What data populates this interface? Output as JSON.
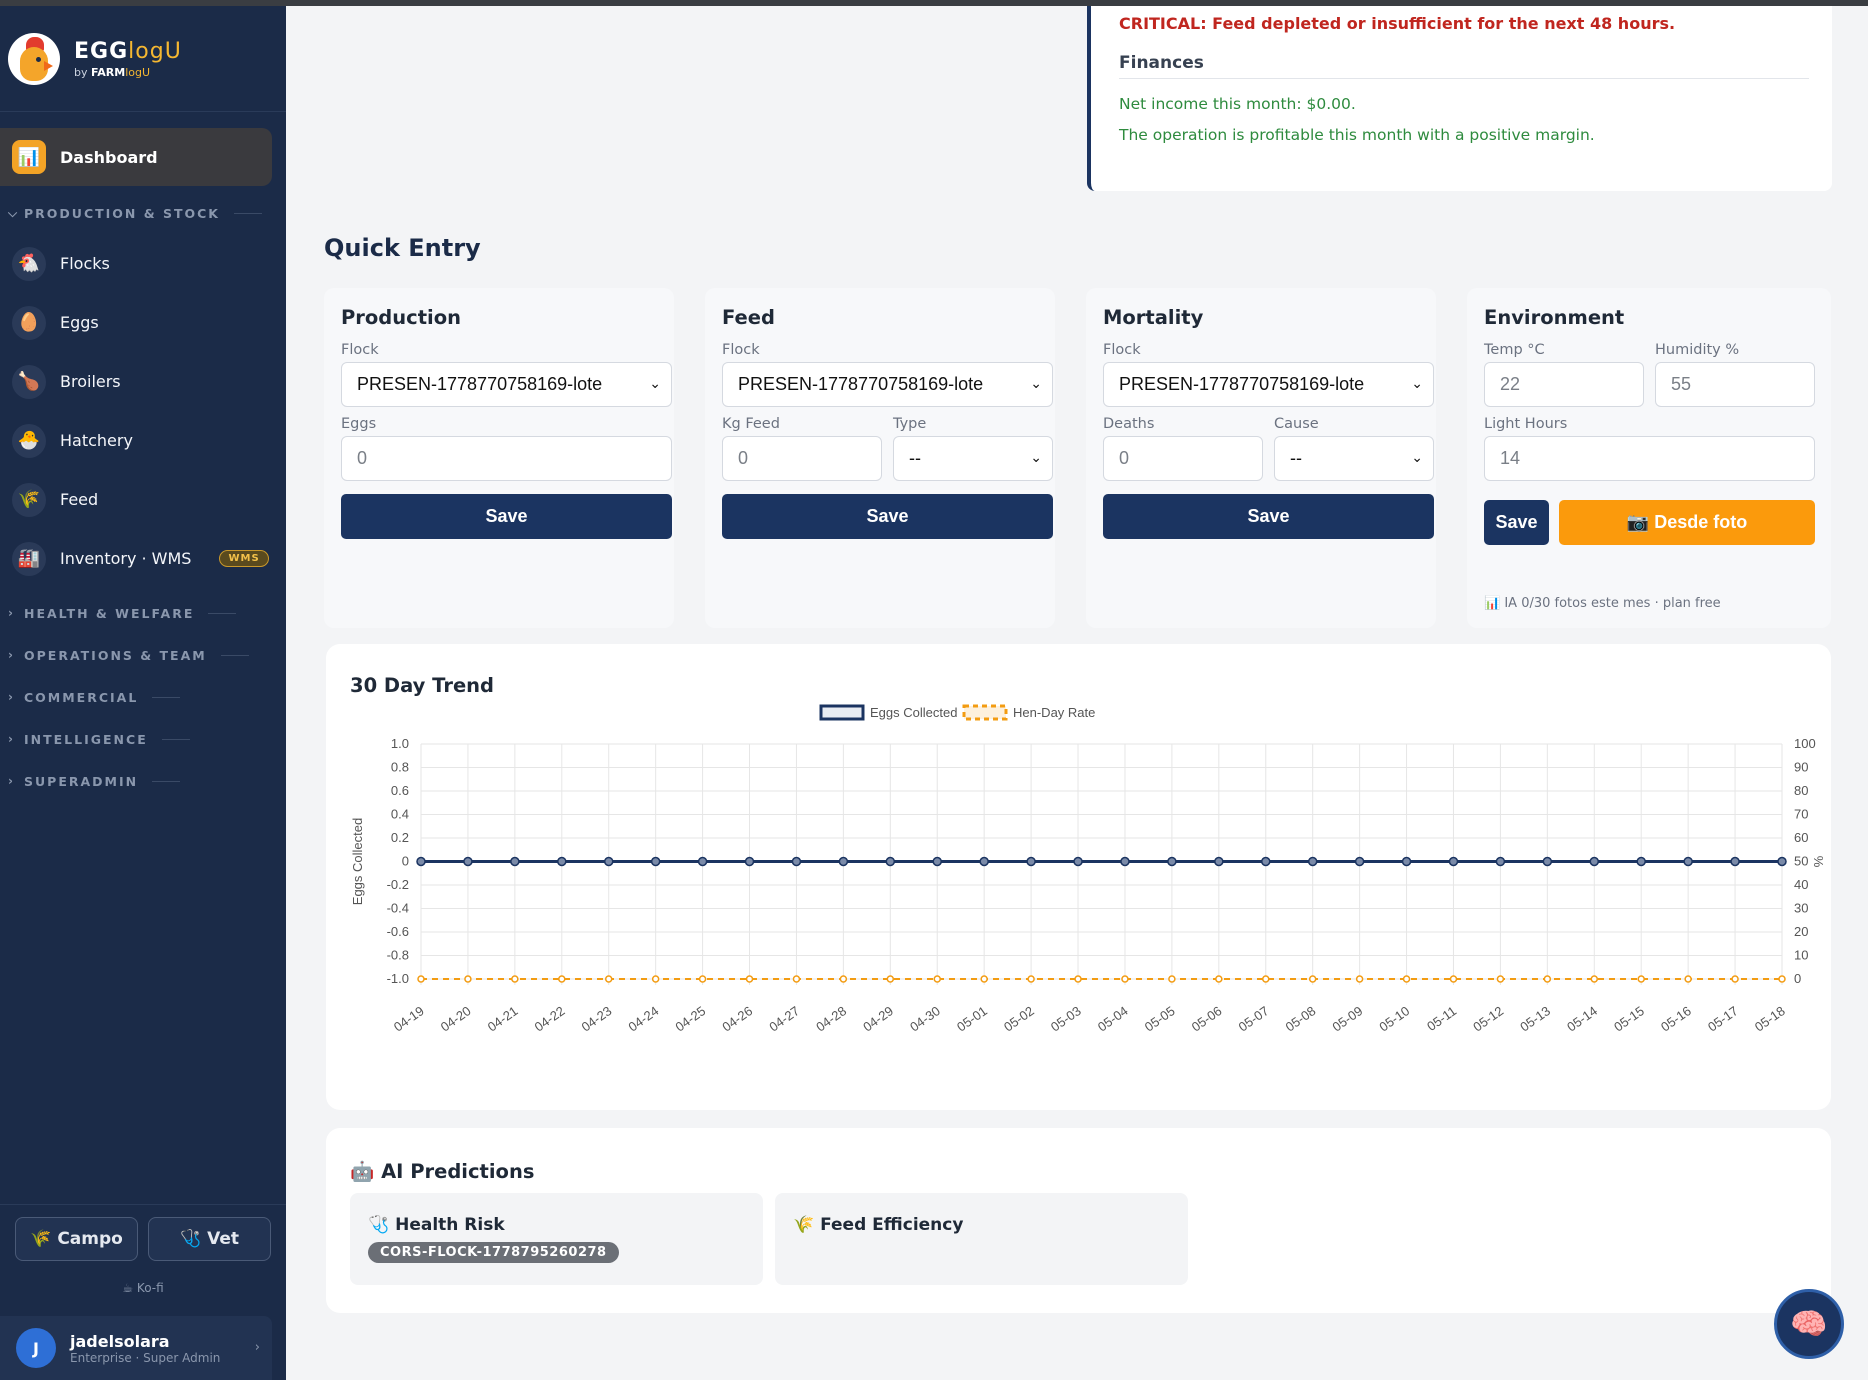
{
  "brand": {
    "name_a": "EGG",
    "name_b": "logU",
    "sub_a": "by ",
    "sub_b": "FARM",
    "sub_c": "logU"
  },
  "sidebar": {
    "active": {
      "label": "Dashboard",
      "icon": "chart-icon"
    },
    "sections": [
      {
        "label": "PRODUCTION & STOCK",
        "expanded": true
      },
      {
        "label": "HEALTH & WELFARE"
      },
      {
        "label": "OPERATIONS & TEAM"
      },
      {
        "label": "COMMERCIAL"
      },
      {
        "label": "INTELLIGENCE"
      },
      {
        "label": "SUPERADMIN"
      }
    ],
    "items": [
      {
        "label": "Flocks",
        "icon": "hen-icon"
      },
      {
        "label": "Eggs",
        "icon": "egg-icon"
      },
      {
        "label": "Broilers",
        "icon": "drumstick-icon"
      },
      {
        "label": "Hatchery",
        "icon": "chick-icon"
      },
      {
        "label": "Feed",
        "icon": "wheat-icon"
      },
      {
        "label": "Inventory · WMS",
        "icon": "factory-icon",
        "badge": "WMS"
      }
    ],
    "buttons": {
      "campo": "Campo",
      "vet": "Vet"
    },
    "kofi": "Ko-fi",
    "user": {
      "initial": "J",
      "name": "jadelsolara",
      "role": "Enterprise · Super Admin"
    }
  },
  "alerts": {
    "critical": "CRITICAL: Feed depleted or insufficient for the next 48 hours.",
    "finances_title": "Finances",
    "net_income": "Net income this month: $0.00.",
    "profit_note": "The operation is profitable this month with a positive margin."
  },
  "quick_entry": {
    "title": "Quick Entry",
    "production": {
      "title": "Production",
      "flock_label": "Flock",
      "flock_value": "PRESEN-1778770758169-lote",
      "eggs_label": "Eggs",
      "eggs_placeholder": "0",
      "save": "Save"
    },
    "feed": {
      "title": "Feed",
      "flock_label": "Flock",
      "flock_value": "PRESEN-1778770758169-lote",
      "kg_label": "Kg Feed",
      "kg_placeholder": "0",
      "type_label": "Type",
      "type_value": "--",
      "save": "Save"
    },
    "mortality": {
      "title": "Mortality",
      "flock_label": "Flock",
      "flock_value": "PRESEN-1778770758169-lote",
      "deaths_label": "Deaths",
      "deaths_placeholder": "0",
      "cause_label": "Cause",
      "cause_value": "--",
      "save": "Save"
    },
    "environment": {
      "title": "Environment",
      "temp_label": "Temp °C",
      "temp_placeholder": "22",
      "humidity_label": "Humidity %",
      "humidity_placeholder": "55",
      "light_label": "Light Hours",
      "light_placeholder": "14",
      "save": "Save",
      "photo": "Desde foto",
      "ia_note": "IA 0/30 fotos este mes · plan free"
    }
  },
  "trend": {
    "title": "30 Day Trend"
  },
  "chart_data": {
    "type": "line",
    "x": [
      "04-19",
      "04-20",
      "04-21",
      "04-22",
      "04-23",
      "04-24",
      "04-25",
      "04-26",
      "04-27",
      "04-28",
      "04-29",
      "04-30",
      "05-01",
      "05-02",
      "05-03",
      "05-04",
      "05-05",
      "05-06",
      "05-07",
      "05-08",
      "05-09",
      "05-10",
      "05-11",
      "05-12",
      "05-13",
      "05-14",
      "05-15",
      "05-16",
      "05-17",
      "05-18"
    ],
    "series": [
      {
        "name": "Eggs Collected",
        "axis": "left",
        "color": "#1b3461",
        "style": "solid",
        "values": [
          0,
          0,
          0,
          0,
          0,
          0,
          0,
          0,
          0,
          0,
          0,
          0,
          0,
          0,
          0,
          0,
          0,
          0,
          0,
          0,
          0,
          0,
          0,
          0,
          0,
          0,
          0,
          0,
          0,
          0
        ]
      },
      {
        "name": "Hen-Day Rate",
        "axis": "right",
        "color": "#f39c12",
        "style": "dashed",
        "values": [
          0,
          0,
          0,
          0,
          0,
          0,
          0,
          0,
          0,
          0,
          0,
          0,
          0,
          0,
          0,
          0,
          0,
          0,
          0,
          0,
          0,
          0,
          0,
          0,
          0,
          0,
          0,
          0,
          0,
          0
        ]
      }
    ],
    "ylabel": "Eggs Collected",
    "y2label": "%",
    "ylim": [
      -1.0,
      1.0
    ],
    "y2lim": [
      0,
      100
    ],
    "yticks": [
      "1.0",
      "0.8",
      "0.6",
      "0.4",
      "0.2",
      "0",
      "-0.2",
      "-0.4",
      "-0.6",
      "-0.8",
      "-1.0"
    ],
    "y2ticks": [
      "100",
      "90",
      "80",
      "70",
      "60",
      "50",
      "40",
      "30",
      "20",
      "10",
      "0"
    ],
    "grid": true,
    "legend": "top-center"
  },
  "ai": {
    "title": "AI Predictions",
    "health": {
      "title": "Health Risk",
      "tag": "CORS-FLOCK-1778795260278"
    },
    "feed": {
      "title": "Feed Efficiency"
    }
  }
}
